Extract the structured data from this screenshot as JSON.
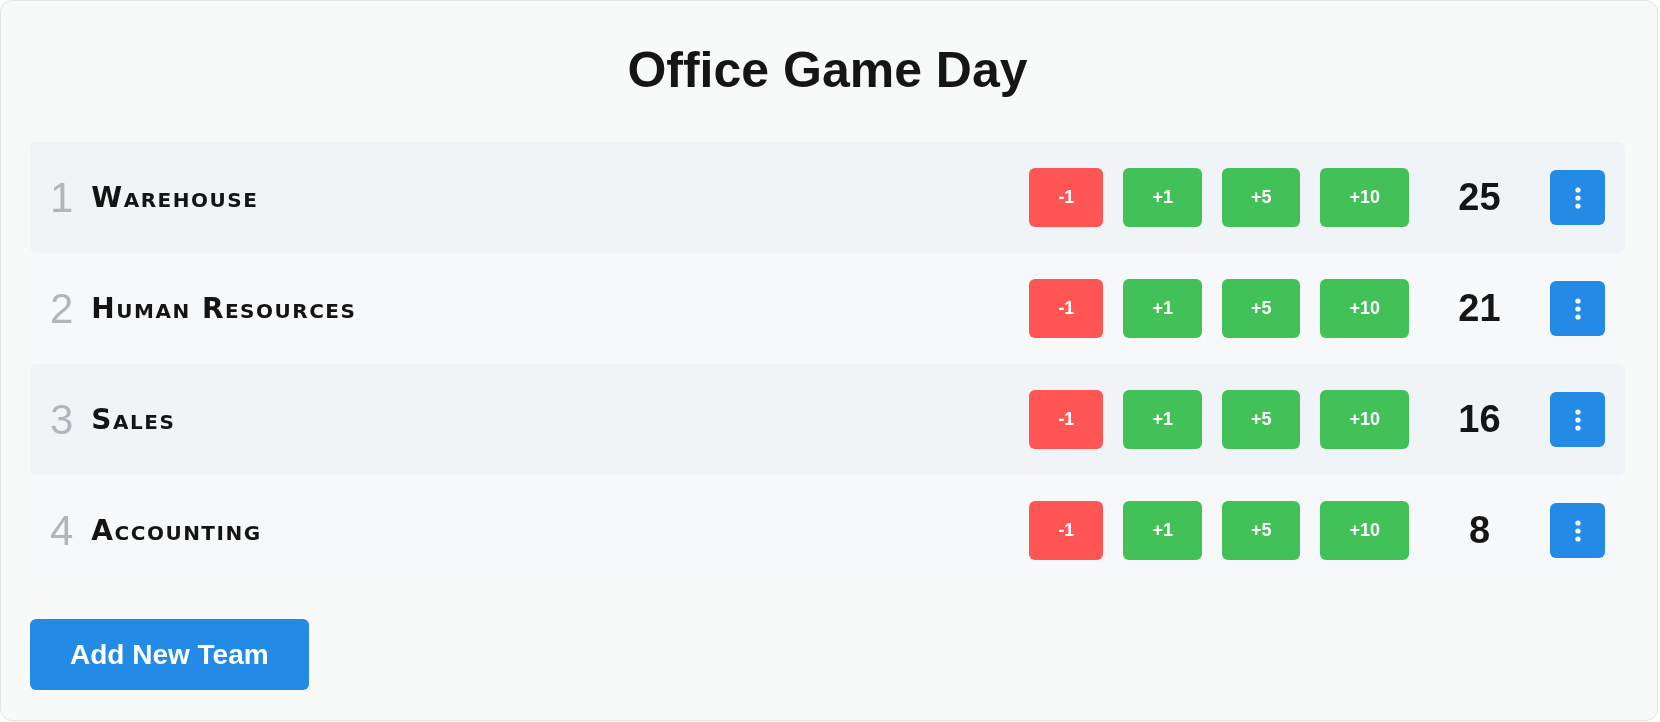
{
  "title": "Office Game Day",
  "teams": [
    {
      "rank": "1",
      "name": "Warehouse",
      "buttons": [
        {
          "label": "-1",
          "kind": "minus"
        },
        {
          "label": "+1",
          "kind": "plus"
        },
        {
          "label": "+5",
          "kind": "plus"
        },
        {
          "label": "+10",
          "kind": "plus"
        }
      ],
      "score": "25"
    },
    {
      "rank": "2",
      "name": "Human Resources",
      "buttons": [
        {
          "label": "-1",
          "kind": "minus"
        },
        {
          "label": "+1",
          "kind": "plus"
        },
        {
          "label": "+5",
          "kind": "plus"
        },
        {
          "label": "+10",
          "kind": "plus"
        }
      ],
      "score": "21"
    },
    {
      "rank": "3",
      "name": "Sales",
      "buttons": [
        {
          "label": "-1",
          "kind": "minus"
        },
        {
          "label": "+1",
          "kind": "plus"
        },
        {
          "label": "+5",
          "kind": "plus"
        },
        {
          "label": "+10",
          "kind": "plus"
        }
      ],
      "score": "16"
    },
    {
      "rank": "4",
      "name": "Accounting",
      "buttons": [
        {
          "label": "-1",
          "kind": "minus"
        },
        {
          "label": "+1",
          "kind": "plus"
        },
        {
          "label": "+5",
          "kind": "plus"
        },
        {
          "label": "+10",
          "kind": "plus"
        }
      ],
      "score": "8"
    }
  ],
  "add_button": "Add New Team"
}
